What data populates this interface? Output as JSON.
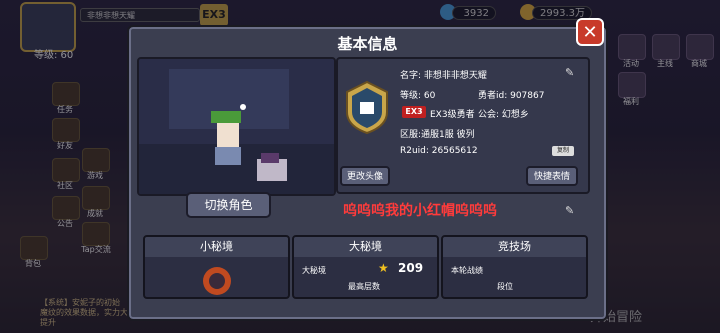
{
  "hud": {
    "player_level": "等级: 60",
    "player_name_tag": "非想非想天耀",
    "ex_badge": "EX3",
    "gems": "3932",
    "gold": "2993.3万",
    "start_button": "开始冒险",
    "chat_line1": "【系统】安妮子的初始",
    "chat_line2": "魔纹的效果数据，实力大大提升"
  },
  "side_left": [
    "任务",
    "好友",
    "游戏",
    "社区",
    "成就",
    "公告",
    "Tap交流",
    "背包"
  ],
  "side_right": [
    "活动",
    "主线",
    "福利",
    "商城"
  ],
  "modal": {
    "title": "基本信息",
    "close_label": "✕",
    "switch_char_label": "切换角色",
    "change_avatar_label": "更改头像",
    "quick_emote_label": "快捷表情",
    "copy_label": "复制",
    "signature": "呜呜呜我的小红帽呜呜呜"
  },
  "info": {
    "name_label": "名字: 非想非非想天耀",
    "level_label": "等级: 60",
    "hero_id_label": "勇者id: 907867",
    "rank_badge": "EX3",
    "rank_label": "EX3级勇者",
    "guild_label": "公会: 幻想乡",
    "server_label": "区服:通服1服 彼列",
    "r2uid_label": "R2uid: 26565612"
  },
  "cards": [
    {
      "title": "小秘境",
      "rows": []
    },
    {
      "title": "大秘境",
      "rows": [
        "大秘境",
        "最高层数"
      ],
      "score": "209"
    },
    {
      "title": "竞技场",
      "rows": [
        "本轮战绩",
        "段位"
      ]
    }
  ],
  "colors": {
    "modal_bg": "#3b3e50",
    "close_red": "#c83a2a",
    "signature_red": "#ff3b3b",
    "gold": "#c9a64a"
  },
  "icons": [
    "gem-icon",
    "gold-coin-icon",
    "close-icon",
    "edit-icon",
    "star-icon"
  ]
}
